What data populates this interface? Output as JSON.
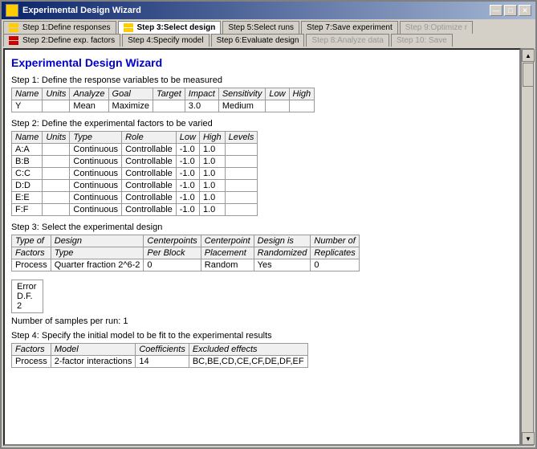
{
  "window": {
    "title": "Experimental Design Wizard",
    "minimize": "—",
    "maximize": "□",
    "close": "✕"
  },
  "tabs_row1": [
    {
      "id": "step1",
      "label": "Step 1:Define responses",
      "icon": "yellow",
      "active": false,
      "disabled": false
    },
    {
      "id": "step3",
      "label": "Step 3:Select design",
      "icon": "yellow",
      "active": true,
      "disabled": false
    },
    {
      "id": "step5",
      "label": "Step 5:Select runs",
      "icon": null,
      "active": false,
      "disabled": false
    },
    {
      "id": "step7",
      "label": "Step 7:Save experiment",
      "icon": null,
      "active": false,
      "disabled": false
    },
    {
      "id": "step9",
      "label": "Step 9:Optimize r",
      "icon": null,
      "active": false,
      "disabled": true
    }
  ],
  "tabs_row2": [
    {
      "id": "step2",
      "label": "Step 2:Define exp. factors",
      "icon": "red",
      "active": false,
      "disabled": false
    },
    {
      "id": "step4",
      "label": "Step 4:Specify model",
      "icon": null,
      "active": false,
      "disabled": false
    },
    {
      "id": "step6",
      "label": "Step 6:Evaluate design",
      "icon": null,
      "active": false,
      "disabled": false
    },
    {
      "id": "step8",
      "label": "Step 8:Analyze data",
      "icon": null,
      "active": false,
      "disabled": true
    },
    {
      "id": "step10",
      "label": "Step 10: Save",
      "icon": null,
      "active": false,
      "disabled": true
    }
  ],
  "page_title": "Experimental Design Wizard",
  "section1": {
    "title": "Step 1: Define the response variables to be measured",
    "columns": [
      "Name",
      "Units",
      "Analyze",
      "Goal",
      "Target",
      "Impact",
      "Sensitivity",
      "Low",
      "High"
    ],
    "rows": [
      [
        "Y",
        "",
        "Mean",
        "Maximize",
        "",
        "3.0",
        "Medium",
        "",
        ""
      ]
    ]
  },
  "section2": {
    "title": "Step 2: Define the experimental factors to be varied",
    "columns": [
      "Name",
      "Units",
      "Type",
      "Role",
      "Low",
      "High",
      "Levels"
    ],
    "rows": [
      [
        "A:A",
        "",
        "Continuous",
        "Controllable",
        "-1.0",
        "1.0",
        ""
      ],
      [
        "B:B",
        "",
        "Continuous",
        "Controllable",
        "-1.0",
        "1.0",
        ""
      ],
      [
        "C:C",
        "",
        "Continuous",
        "Controllable",
        "-1.0",
        "1.0",
        ""
      ],
      [
        "D:D",
        "",
        "Continuous",
        "Controllable",
        "-1.0",
        "1.0",
        ""
      ],
      [
        "E:E",
        "",
        "Continuous",
        "Controllable",
        "-1.0",
        "1.0",
        ""
      ],
      [
        "F:F",
        "",
        "Continuous",
        "Controllable",
        "-1.0",
        "1.0",
        ""
      ]
    ]
  },
  "section3": {
    "title": "Step 3: Select the experimental design",
    "header_row1": [
      "Type of",
      "Design",
      "",
      "Centerpoints",
      "Centerpoint",
      "Design is",
      "Number of"
    ],
    "header_row2": [
      "Factors",
      "Type",
      "",
      "Per Block",
      "Placement",
      "Randomized",
      "Replicates"
    ],
    "rows": [
      [
        "Process",
        "Quarter fraction 2^6-2",
        "",
        "0",
        "Random",
        "Yes",
        "0"
      ]
    ]
  },
  "error_box": {
    "label": "Error",
    "df_label": "D.F.",
    "value": "2"
  },
  "samples_text": "Number of samples per run: 1",
  "section4": {
    "title": "Step 4: Specify the initial model to be fit to the experimental results",
    "columns": [
      "Factors",
      "Model",
      "Coefficients",
      "Excluded effects"
    ],
    "rows": [
      [
        "Process",
        "2-factor interactions",
        "14",
        "BC,BE,CD,CE,CF,DE,DF,EF"
      ]
    ]
  }
}
